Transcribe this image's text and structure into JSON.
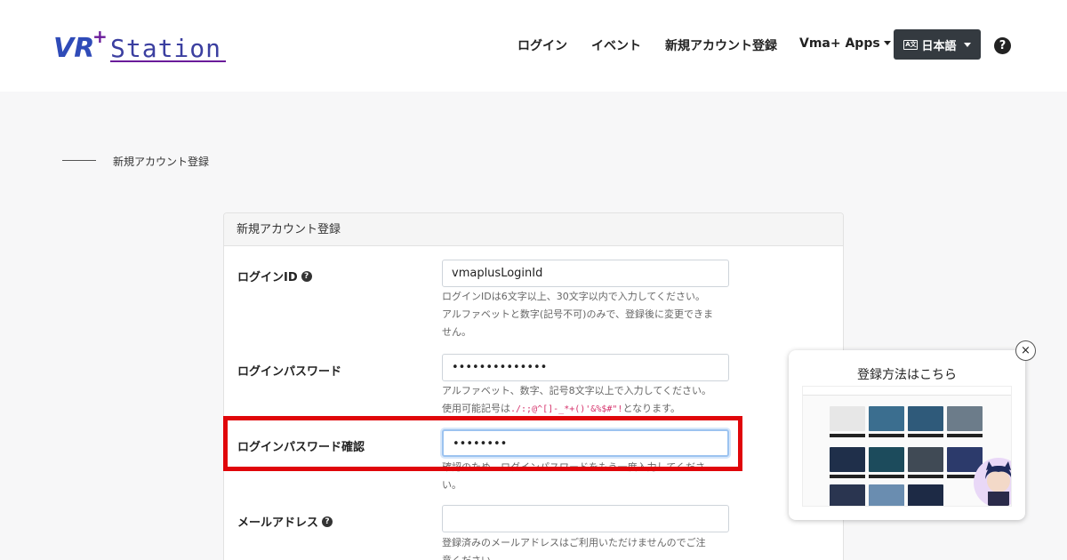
{
  "header": {
    "logo_text": "VR+ Station",
    "nav": {
      "login": "ログイン",
      "event": "イベント",
      "signup": "新規アカウント登録",
      "apps": "Vma+ Apps",
      "language": "日本語",
      "help": "?"
    },
    "colors": {
      "logo_blue": "#2f4bb8",
      "logo_purple": "#6a1b9a",
      "lang_bg": "#343a40"
    }
  },
  "breadcrumb": {
    "current": "新規アカウント登録"
  },
  "form": {
    "card_title": "新規アカウント登録",
    "login_id": {
      "label": "ログインID",
      "value": "vmaplusLoginId",
      "help_line1": "ログインIDは6文字以上、30文字以内で入力してください。",
      "help_line2": "アルファベットと数字(記号不可)のみで、登録後に変更できま",
      "help_line3": "せん。"
    },
    "password": {
      "label": "ログインパスワード",
      "value": "••••••••••••••",
      "help_line1": "アルファベット、数字、記号8文字以上で入力してください。",
      "help_prefix": "使用可能記号は",
      "symbols": "./:;@^[]-_*+()'&%$#\"!",
      "help_suffix": "となります。"
    },
    "password_confirm": {
      "label": "ログインパスワード確認",
      "value": "••••••••",
      "help_line1": "確認のため、ログインパスワードをもう一度入力してくださ",
      "help_line2": "い。"
    },
    "email": {
      "label": "メールアドレス",
      "value": "",
      "help_line1": "登録済みのメールアドレスはご利用いただけませんのでご注",
      "help_line2": "意ください。"
    },
    "highlight_color": "#e0060a"
  },
  "popup": {
    "title": "登録方法はこちら",
    "close_icon": "×"
  }
}
